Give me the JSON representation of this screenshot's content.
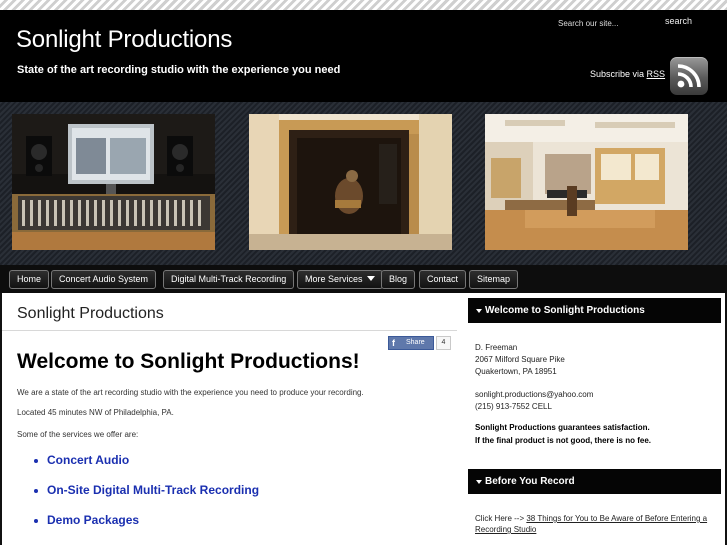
{
  "header": {
    "site_title": "Sonlight Productions",
    "tagline": "State of the art recording studio with the experience you need",
    "search_placeholder": "Search our site...",
    "search_button": "search",
    "subscribe_prefix": "Subscribe via",
    "subscribe_link": "RSS"
  },
  "banner": {
    "photos": [
      "photo-control-room",
      "photo-vocal-booth",
      "photo-live-room"
    ]
  },
  "nav": {
    "items": [
      "Home",
      "Concert Audio System",
      "Digital Multi-Track Recording",
      "More Services",
      "Blog",
      "Contact",
      "Sitemap"
    ]
  },
  "main": {
    "page_heading": "Sonlight Productions",
    "share_label": "Share",
    "share_count": "4",
    "welcome_title": "Welcome to Sonlight Productions!",
    "paragraphs": [
      "We are a state of the art recording studio with the experience you need to produce your recording.",
      "Located 45 minutes NW of Philadelphia, PA.",
      "Some of the services we offer are:"
    ],
    "services": [
      "Concert Audio",
      "On-Site Digital Multi-Track Recording",
      "Demo Packages"
    ]
  },
  "sidebar": {
    "welcome_heading": "Welcome to Sonlight Productions",
    "contact_lines": [
      "D. Freeman",
      "2067 Milford Square Pike",
      "Quakertown, PA 18951"
    ],
    "email": "sonlight.productions@yahoo.com",
    "phone": "(215) 913-7552 CELL",
    "guarantee_lines": [
      "Sonlight Productions guarantees satisfaction.",
      "If the final product is not good, there is no fee."
    ],
    "before_heading": "Before You Record",
    "click_prefix": "Click Here -->",
    "before_link": "38 Things for You to Be Aware of Before Entering a Recording Studio"
  },
  "colors": {
    "header_bg": "#000000",
    "link_blue": "#1a2fb0",
    "facebook_blue": "#5f78ab"
  }
}
